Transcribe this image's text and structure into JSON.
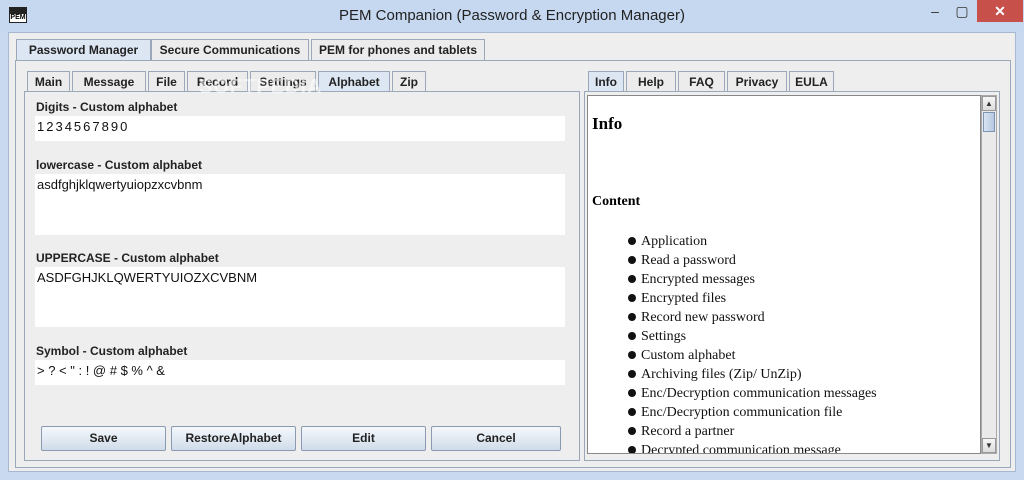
{
  "window": {
    "title": "PEM Companion (Password & Encryption Manager)",
    "icon_text": "PEM",
    "controls": {
      "minimize": "–",
      "maximize": "▢",
      "close": "✕"
    }
  },
  "main_tabs": [
    {
      "label": "Password Manager",
      "active": true
    },
    {
      "label": "Secure Communications",
      "active": false
    },
    {
      "label": "PEM for phones and tablets",
      "active": false
    }
  ],
  "sub_tabs": [
    {
      "label": "Main",
      "active": false
    },
    {
      "label": "Message",
      "active": false
    },
    {
      "label": "File",
      "active": false
    },
    {
      "label": "Record",
      "active": false
    },
    {
      "label": "Settings",
      "active": false
    },
    {
      "label": "Alphabet",
      "active": true
    },
    {
      "label": "Zip",
      "active": false
    }
  ],
  "watermark": "SOFTPEDIA",
  "alphabet": {
    "digits_label": "Digits - Custom alphabet",
    "digits_value": "1234567890",
    "lowercase_label": "lowercase - Custom alphabet",
    "lowercase_value": "asdfghjklqwertyuiopzxcvbnm",
    "uppercase_label": "UPPERCASE - Custom alphabet",
    "uppercase_value": "ASDFGHJKLQWERTYUIOZXCVBNM",
    "symbol_label": "Symbol - Custom alphabet",
    "symbol_value": "> ? < \" : ! @ # $ % ^ &"
  },
  "buttons": {
    "save": "Save",
    "restore": "RestoreAlphabet",
    "edit": "Edit",
    "cancel": "Cancel"
  },
  "info_tabs": [
    {
      "label": "Info",
      "active": true
    },
    {
      "label": "Help",
      "active": false
    },
    {
      "label": "FAQ",
      "active": false
    },
    {
      "label": "Privacy",
      "active": false
    },
    {
      "label": "EULA",
      "active": false
    }
  ],
  "info": {
    "heading": "Info",
    "content_heading": "Content",
    "items": [
      "Application",
      "Read a password",
      "Encrypted messages",
      "Encrypted files",
      "Record new password",
      "Settings",
      "Custom alphabet",
      "Archiving files (Zip/ UnZip)",
      "Enc/Decryption communication messages",
      "Enc/Decryption communication file",
      "Record a partner",
      "Decrypted communication message"
    ]
  },
  "scrollbar": {
    "up": "▲",
    "down": "▼"
  }
}
